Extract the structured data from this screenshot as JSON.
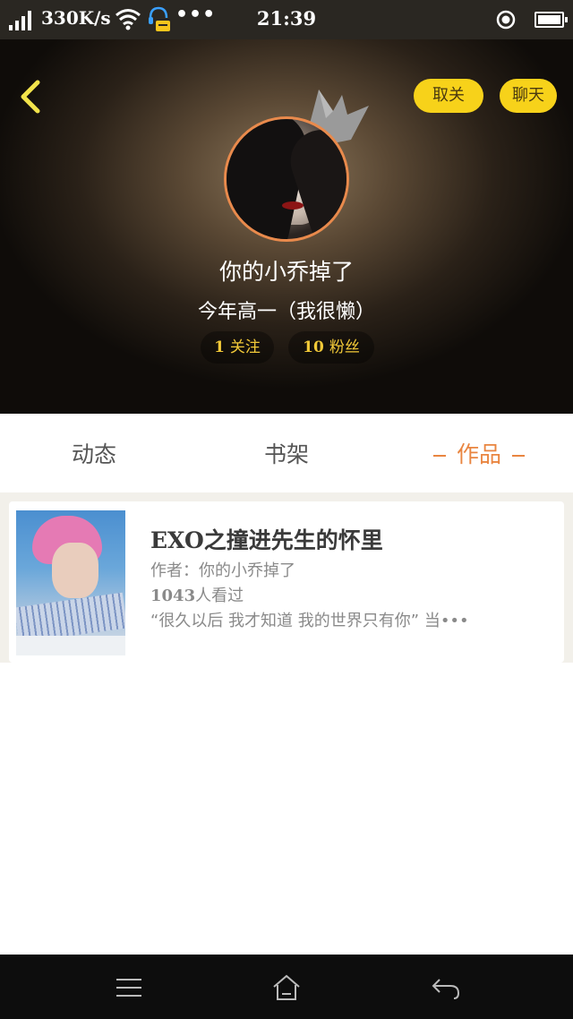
{
  "status_bar": {
    "speed": "330K/s",
    "dots": "•••",
    "time": "21:39"
  },
  "header": {
    "unfollow_label": "取关",
    "chat_label": "聊天",
    "username": "你的小乔掉了",
    "bio": "今年高一（我很懒）",
    "follow_count": "1",
    "follow_label": "关注",
    "fans_count": "10",
    "fans_label": "粉丝"
  },
  "tabs": [
    {
      "label": "动态",
      "active": false
    },
    {
      "label": "书架",
      "active": false
    },
    {
      "label": "作品",
      "active": true
    }
  ],
  "works": [
    {
      "title": "EXO之撞进先生的怀里",
      "author": "作者：你的小乔掉了",
      "views_number": "1043",
      "views_label": "人看过",
      "description": "“很久以后 我才知道 我的世界只有你” 当•••"
    }
  ],
  "colors": {
    "accent_orange": "#e98540",
    "pill_yellow": "#f7d21a",
    "stat_gold": "#f2c938",
    "avatar_ring": "#e98a4c"
  },
  "icons": {
    "back": "chevron-left-icon",
    "crown": "crown-icon",
    "menu": "menu-icon",
    "home": "home-icon",
    "return": "return-icon"
  }
}
